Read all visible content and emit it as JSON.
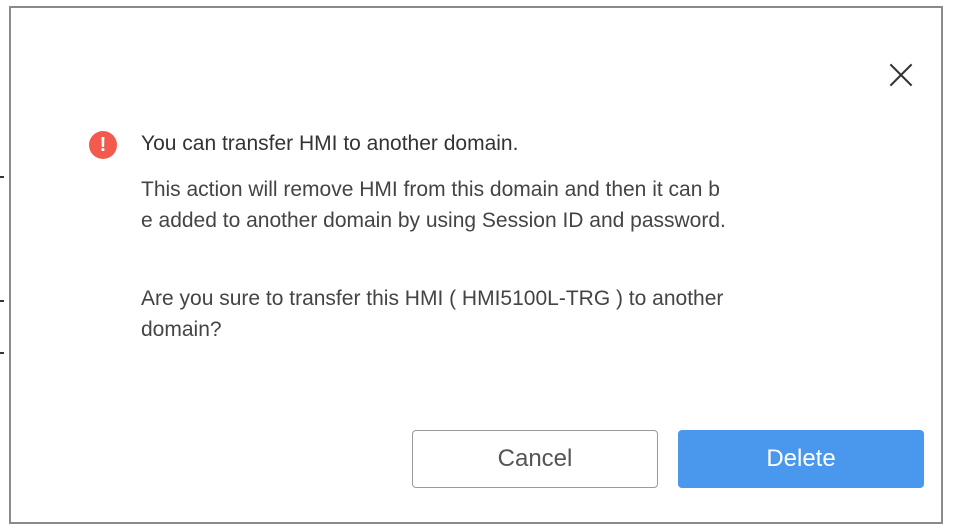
{
  "dialog": {
    "title": "You can transfer HMI to another domain.",
    "description_lines": [
      "This action will remove HMI from this domain and then it can b",
      "e added to another domain by using Session ID and password."
    ],
    "confirm_lines": [
      "Are you sure to transfer this HMI ( HMI5100L-TRG ) to another",
      "domain?"
    ],
    "close_icon": "close-icon",
    "warning_icon": "exclamation-circle-icon",
    "warning_symbol": "!",
    "buttons": {
      "cancel_label": "Cancel",
      "delete_label": "Delete"
    }
  },
  "colors": {
    "warning": "#f25a4d",
    "primary": "#4a97ee"
  }
}
